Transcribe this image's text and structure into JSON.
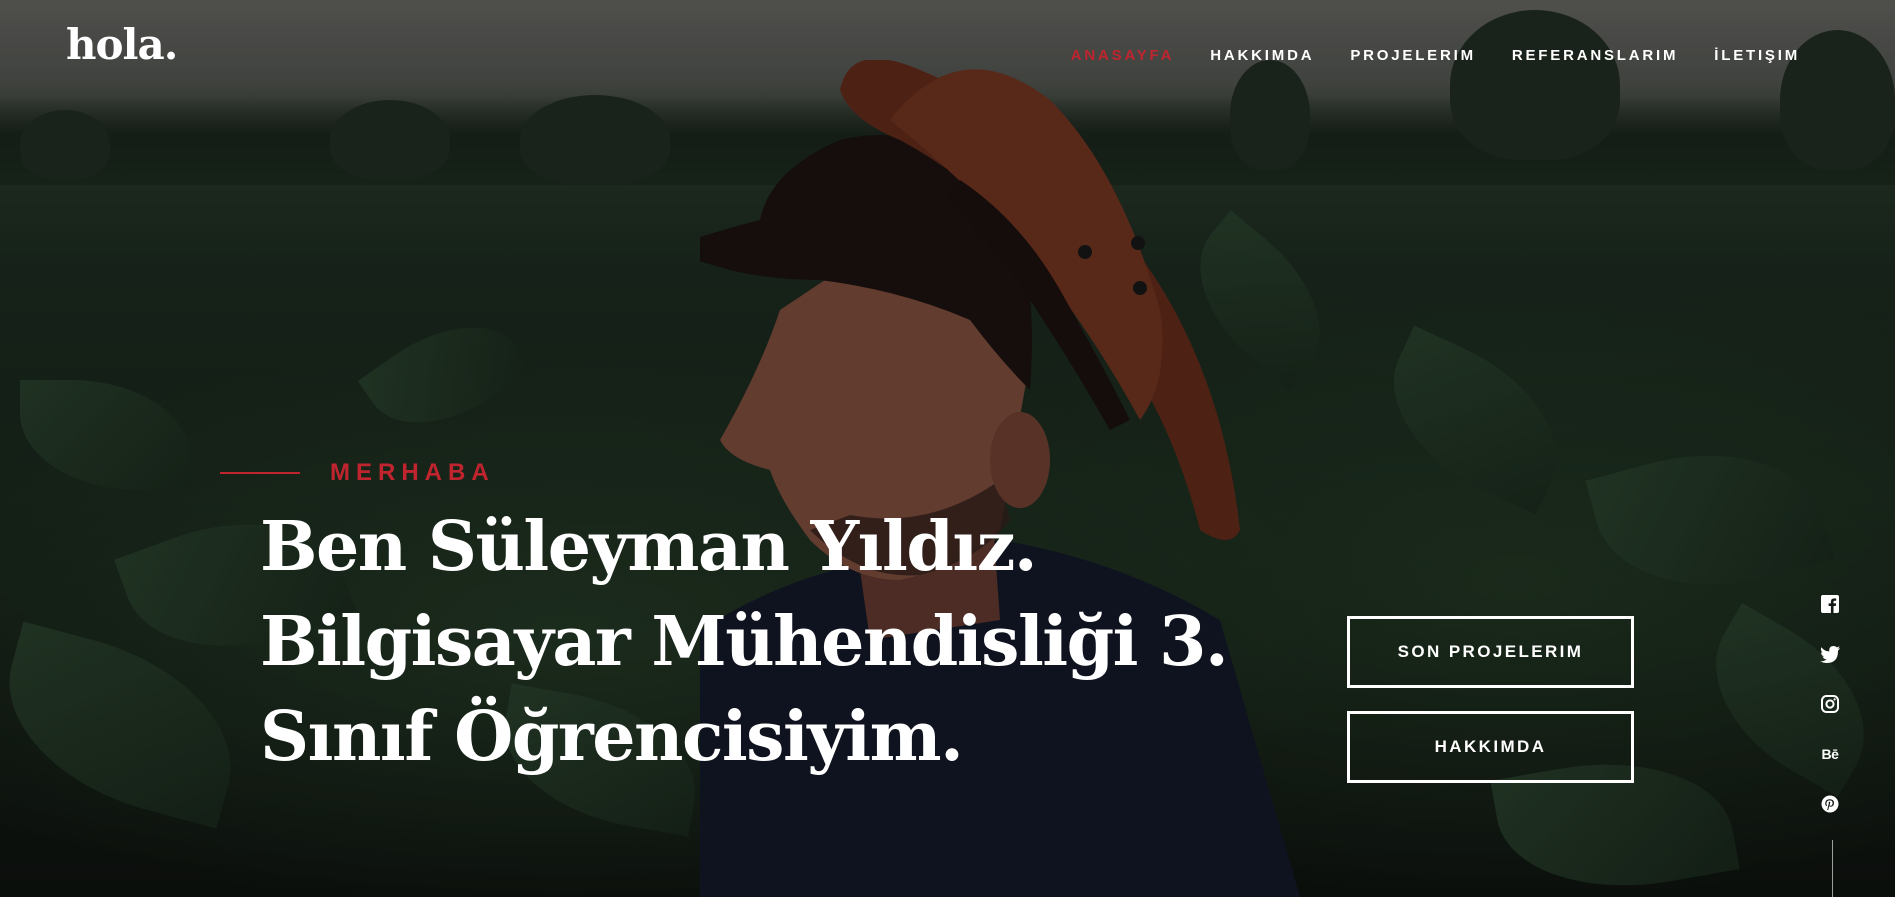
{
  "header": {
    "logo": "hola.",
    "nav": [
      {
        "label": "ANASAYFA",
        "active": true
      },
      {
        "label": "HAKKIMDA",
        "active": false
      },
      {
        "label": "PROJELERIM",
        "active": false
      },
      {
        "label": "REFERANSLARIM",
        "active": false
      },
      {
        "label": "İLETIŞIM",
        "active": false
      }
    ]
  },
  "hero": {
    "kicker": "MERHABA",
    "headline": [
      "Ben Süleyman Yıldız.",
      "Bilgisayar Mühendisliği 3.",
      "Sınıf Öğrencisiyim."
    ],
    "buttons": {
      "projects": "SON PROJELERIM",
      "about": "HAKKIMDA"
    }
  },
  "social": {
    "icons": [
      "facebook-icon",
      "twitter-icon",
      "instagram-icon",
      "behance-icon",
      "pinterest-icon"
    ],
    "behance_glyph": "Bē"
  },
  "colors": {
    "accent": "#c0242f",
    "text": "#ffffff",
    "overlay": "#000000"
  }
}
